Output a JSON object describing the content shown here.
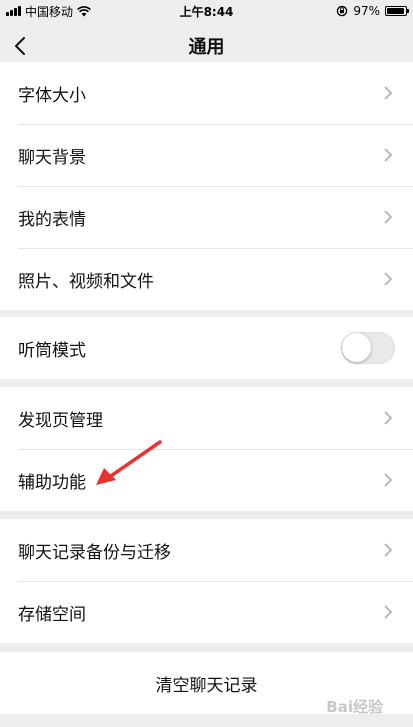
{
  "status_bar": {
    "carrier": "中国移动",
    "time": "上午8:44",
    "battery": "97%",
    "battery_level": 0.97
  },
  "nav": {
    "title": "通用",
    "back_icon": "chevron-left-icon"
  },
  "groups": [
    {
      "items": [
        {
          "label": "字体大小",
          "type": "link"
        },
        {
          "label": "聊天背景",
          "type": "link"
        },
        {
          "label": "我的表情",
          "type": "link"
        },
        {
          "label": "照片、视频和文件",
          "type": "link"
        }
      ]
    },
    {
      "items": [
        {
          "label": "听筒模式",
          "type": "toggle",
          "on": false
        }
      ]
    },
    {
      "items": [
        {
          "label": "发现页管理",
          "type": "link"
        },
        {
          "label": "辅助功能",
          "type": "link"
        }
      ]
    },
    {
      "items": [
        {
          "label": "聊天记录备份与迁移",
          "type": "link"
        },
        {
          "label": "存储空间",
          "type": "link"
        }
      ]
    }
  ],
  "actions": {
    "clear_chat": "清空聊天记录"
  },
  "annotation": {
    "icon": "red-arrow-icon",
    "color": "#e8322f"
  },
  "watermark": "Bai经验"
}
